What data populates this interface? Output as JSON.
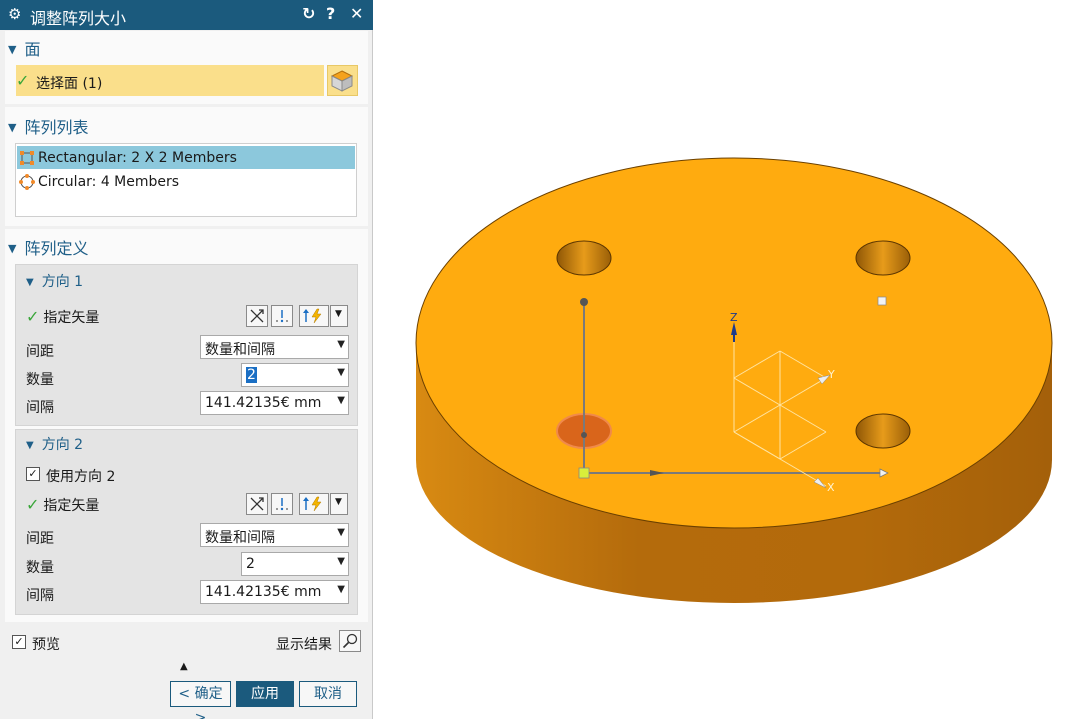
{
  "dialog": {
    "title": "调整阵列大小",
    "reset_glyph": "↻",
    "help_glyph": "?",
    "close_glyph": "✕"
  },
  "face_section": {
    "header": "面",
    "select_label": "选择面 (1)"
  },
  "pattern_list": {
    "header": "阵列列表",
    "items": [
      {
        "label": "Rectangular: 2 X 2 Members",
        "selected": true,
        "icon": "rectangular-pattern-icon"
      },
      {
        "label": "Circular: 4 Members",
        "selected": false,
        "icon": "circular-pattern-icon"
      }
    ]
  },
  "pattern_def": {
    "header": "阵列定义",
    "direction1": {
      "header": "方向 1",
      "specify_vector": "指定矢量",
      "spacing_label": "间距",
      "spacing_value": "数量和间隔",
      "count_label": "数量",
      "count_value": "2",
      "pitch_label": "间隔",
      "pitch_value": "141.42135€ mm"
    },
    "direction2": {
      "header": "方向 2",
      "use_direction_label": "使用方向 2",
      "use_direction_checked": true,
      "specify_vector": "指定矢量",
      "spacing_label": "间距",
      "spacing_value": "数量和间隔",
      "count_label": "数量",
      "count_value": "2",
      "pitch_label": "间隔",
      "pitch_value": "141.42135€ mm"
    }
  },
  "preview": {
    "label": "预览",
    "checked": true,
    "show_result": "显示结果"
  },
  "buttons": {
    "ok": "< 确定 >",
    "apply": "应用",
    "cancel": "取消"
  },
  "viewport": {
    "axis_labels": {
      "x": "X",
      "y": "Y",
      "z": "Z"
    }
  },
  "colors": {
    "title_bar": "#1b5a7d",
    "section_header": "#1f5f88",
    "face_highlight": "#fadf8b",
    "list_selection": "#8cc8dc",
    "part_top": "#ffab0f",
    "part_side": "#c77d12",
    "checkmark": "#3aa63a"
  }
}
